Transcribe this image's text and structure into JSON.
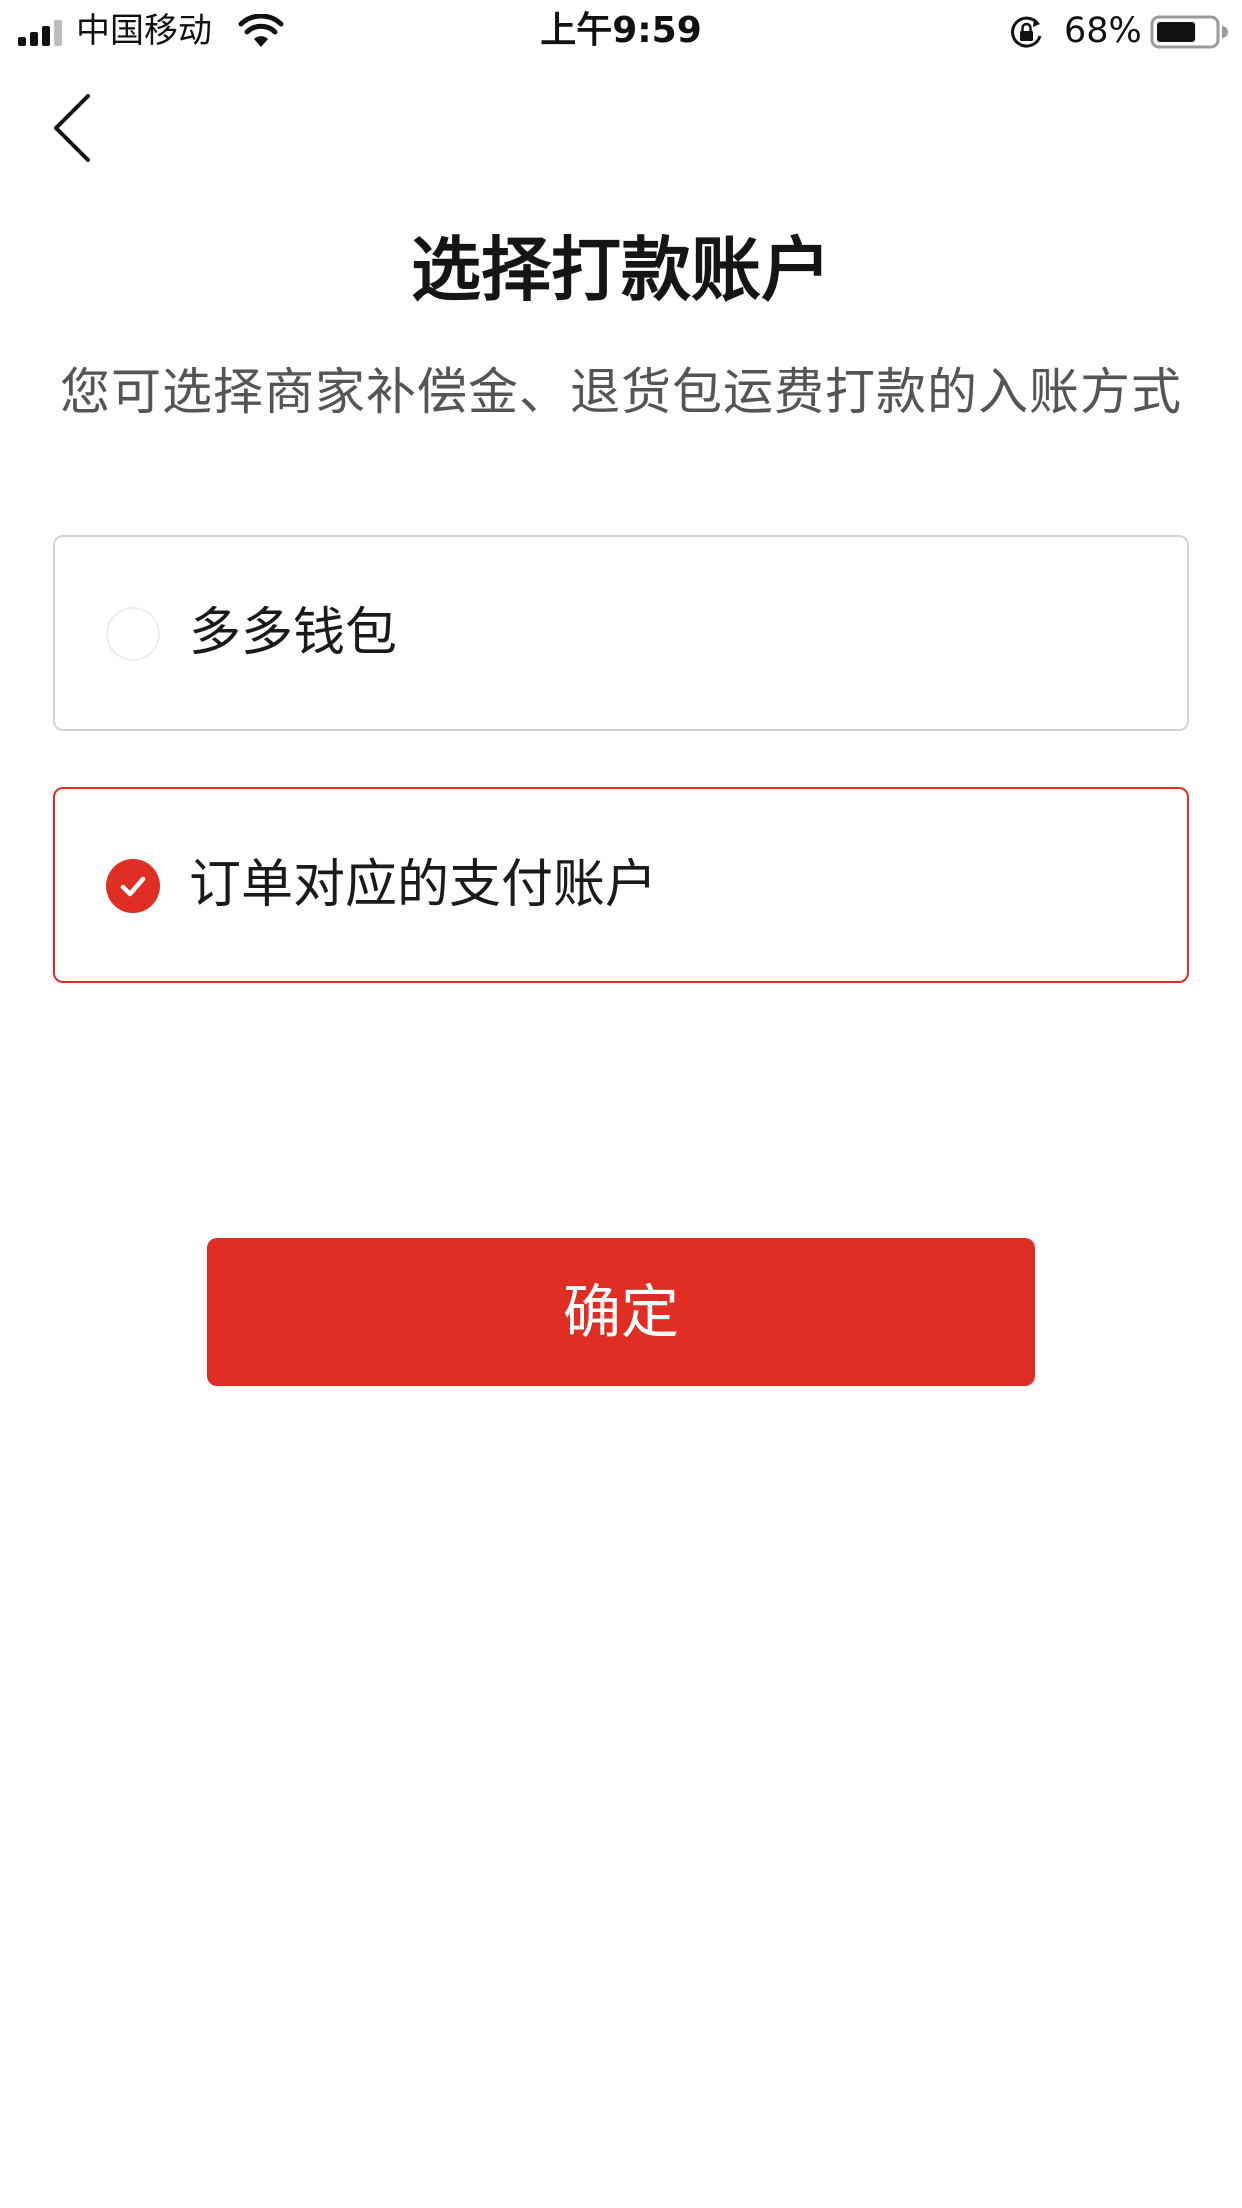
{
  "status_bar": {
    "carrier": "中国移动",
    "time": "上午9:59",
    "battery_percent": "68%",
    "battery_level": 0.68,
    "icons": [
      "signal-icon",
      "wifi-icon",
      "rotation-lock-icon",
      "battery-icon"
    ]
  },
  "header": {
    "back_icon": "chevron-left-icon",
    "title": "选择打款账户",
    "subtitle": "您可选择商家补偿金、退货包运费打款的入账方式"
  },
  "options": [
    {
      "label": "多多钱包",
      "selected": false
    },
    {
      "label": "订单对应的支付账户",
      "selected": true
    }
  ],
  "confirm_button": {
    "label": "确定"
  },
  "colors": {
    "accent": "#e02e24",
    "border": "#d5d5d5",
    "subtitle_text": "#555555",
    "background": "#ffffff"
  }
}
